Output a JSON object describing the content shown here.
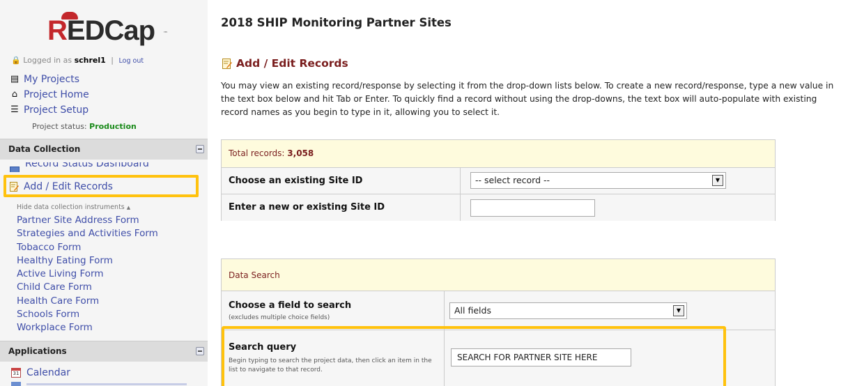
{
  "logo": {
    "brand": "REDCap",
    "tm": "™"
  },
  "login": {
    "prefix": "Logged in as",
    "username": "schrel1",
    "separator": "|",
    "logout_label": "Log out"
  },
  "nav": {
    "my_projects": "My Projects",
    "project_home": "Project Home",
    "project_setup": "Project Setup",
    "status_label": "Project status:",
    "status_value": "Production"
  },
  "data_collection": {
    "title": "Data Collection",
    "record_status": "Record Status Dashboard",
    "add_edit": "Add / Edit Records",
    "hide_instruments": "Hide data collection instruments",
    "instruments": [
      "Partner Site Address Form",
      "Strategies and Activities Form",
      "Tobacco Form",
      "Healthy Eating Form",
      "Active Living Form",
      "Child Care Form",
      "Health Care Form",
      "Schools Form",
      "Workplace Form"
    ]
  },
  "applications": {
    "title": "Applications",
    "calendar": "Calendar",
    "calendar_day": "31"
  },
  "main": {
    "project_title": "2018 SHIP Monitoring Partner Sites",
    "heading": "Add / Edit Records",
    "intro": "You may view an existing record/response by selecting it from the drop-down lists below. To create a new record/response, type a new value in the text box below and hit Tab or Enter. To quickly find a record without using the drop-downs, the text box will auto-populate with existing record names as you begin to type in it, allowing you to select it."
  },
  "records_box": {
    "total_label": "Total records:",
    "total_value": "3,058",
    "choose_label": "Choose an existing Site ID",
    "select_value": "-- select record --",
    "enter_label": "Enter a new or existing Site ID",
    "enter_value": ""
  },
  "search_box": {
    "title": "Data Search",
    "field_label": "Choose a field to search",
    "field_sublabel": "(excludes multiple choice fields)",
    "field_value": "All fields",
    "query_label": "Search query",
    "query_help": "Begin typing to search the project data, then click an item in the list to navigate to that record.",
    "query_value": "SEARCH FOR PARTNER SITE HERE"
  },
  "highlight_color": "#ffc20e"
}
